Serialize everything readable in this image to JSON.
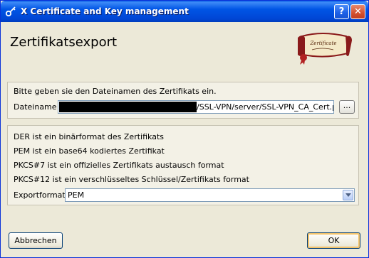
{
  "window": {
    "title": "X Certificate and Key management",
    "help_button": "?",
    "close_button": "✕"
  },
  "page": {
    "heading": "Zertifikatsexport",
    "logo_text": "Zertificate"
  },
  "file_group": {
    "instruction": "Bitte geben sie den Dateinamen des Zertifikats ein.",
    "filename_label": "Dateiname",
    "filename_value": "/SSL-VPN/server/SSL-VPN_CA_Cert.pem",
    "browse_label": "..."
  },
  "format_group": {
    "lines": [
      "DER ist ein binärformat des Zertifikats",
      "PEM ist ein base64 kodiertes Zertifikat",
      "PKCS#7 ist ein offizielles Zertifikats austausch format",
      "PKCS#12 ist ein verschlüsseltes Schlüssel/Zertifikats format"
    ],
    "export_label": "Exportformat",
    "export_value": "PEM"
  },
  "buttons": {
    "cancel": "Abbrechen",
    "ok": "OK"
  }
}
